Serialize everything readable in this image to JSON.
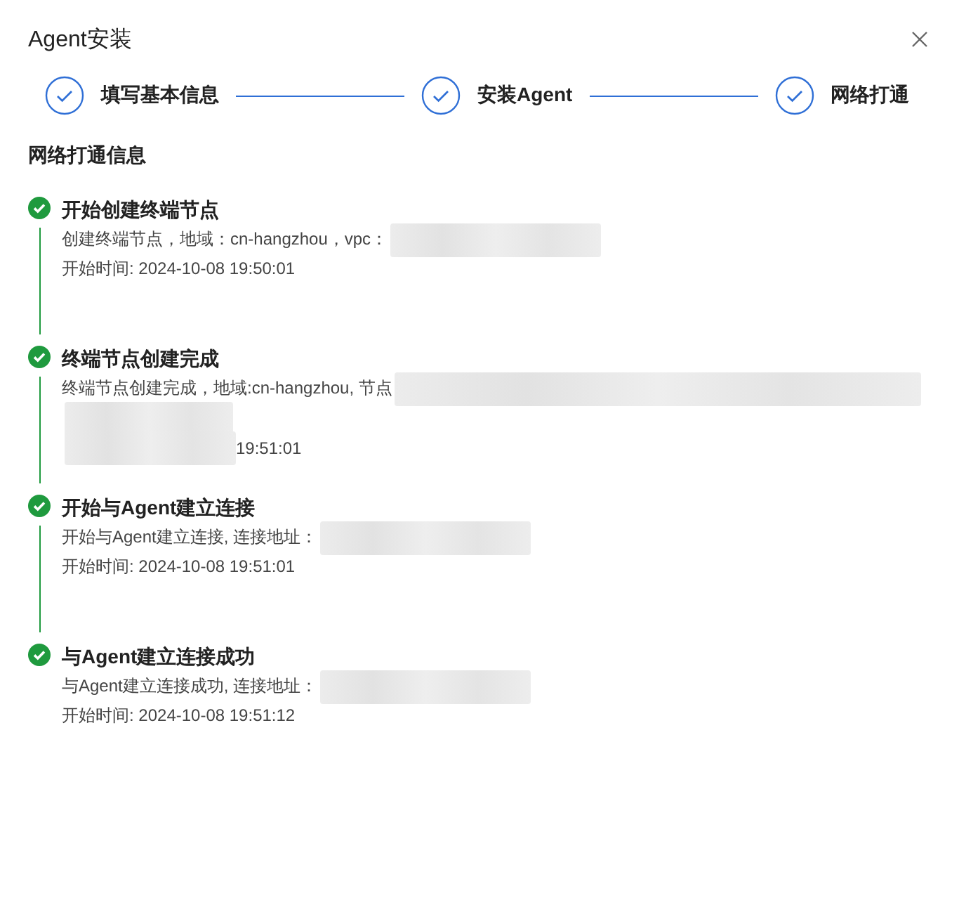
{
  "dialog": {
    "title": "Agent安装"
  },
  "steps": [
    {
      "label": "填写基本信息",
      "done": true
    },
    {
      "label": "安装Agent",
      "done": true
    },
    {
      "label": "网络打通",
      "done": true
    }
  ],
  "section_title": "网络打通信息",
  "events": [
    {
      "title": "开始创建终端节点",
      "success": true,
      "lines": [
        {
          "text": "创建终端节点，地域：cn-hangzhou，vpc：",
          "masked_after": true
        },
        {
          "text": "开始时间: 2024-10-08 19:50:01"
        }
      ]
    },
    {
      "title": "终端节点创建完成",
      "success": true,
      "lines": [
        {
          "text": "终端节点创建完成，地域:cn-hangzhou, 节点",
          "masked_after": true
        },
        {
          "masked_after": true
        },
        {
          "text": "19:51:01",
          "masked_before": true
        }
      ]
    },
    {
      "title": "开始与Agent建立连接",
      "success": true,
      "lines": [
        {
          "text": "开始与Agent建立连接, 连接地址：",
          "masked_after": true
        },
        {
          "text": "开始时间: 2024-10-08 19:51:01"
        }
      ]
    },
    {
      "title": "与Agent建立连接成功",
      "success": true,
      "lines": [
        {
          "text": "与Agent建立连接成功, 连接地址：",
          "masked_after": true
        },
        {
          "text": "开始时间: 2024-10-08 19:51:12"
        }
      ]
    }
  ]
}
